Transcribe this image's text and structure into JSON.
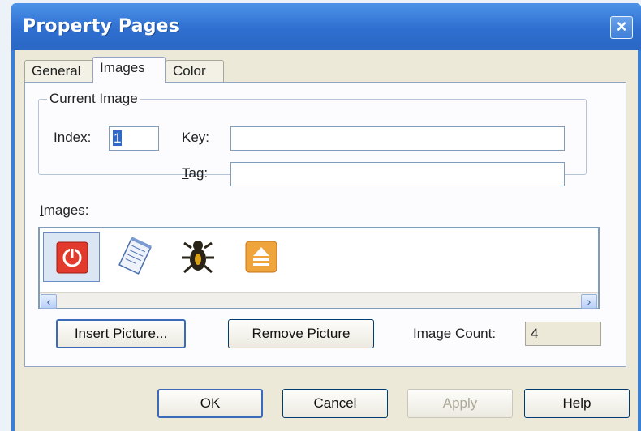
{
  "window": {
    "title": "Property Pages"
  },
  "tabs": [
    {
      "label": "General"
    },
    {
      "label": "Images"
    },
    {
      "label": "Color"
    }
  ],
  "current_image": {
    "group_label": "Current Image",
    "index": {
      "label_pre": "",
      "label_ul": "I",
      "label_post": "ndex:",
      "value": "1"
    },
    "key": {
      "label_pre": "",
      "label_ul": "K",
      "label_post": "ey:",
      "value": ""
    },
    "tag": {
      "label_pre": "",
      "label_ul": "T",
      "label_post": "ag:",
      "value": ""
    }
  },
  "images": {
    "label_pre": "",
    "label_ul": "I",
    "label_post": "mages:",
    "items": [
      {
        "icon": "power-icon",
        "selected": true
      },
      {
        "icon": "notepad-icon",
        "selected": false
      },
      {
        "icon": "bug-icon",
        "selected": false
      },
      {
        "icon": "eject-icon",
        "selected": false
      }
    ],
    "scroll_left": "‹",
    "scroll_right": "›"
  },
  "buttons": {
    "insert": {
      "pre": "Insert ",
      "ul": "P",
      "post": "icture..."
    },
    "remove": {
      "pre": "",
      "ul": "R",
      "post": "emove Picture"
    }
  },
  "image_count": {
    "label": "Image Count:",
    "value": "4"
  },
  "footer": {
    "ok": "OK",
    "cancel": "Cancel",
    "apply": "Apply",
    "help": "Help"
  },
  "colors": {
    "title_bar": "#2f6fd0",
    "face": "#ece9d8",
    "selection": "#3169c6"
  }
}
